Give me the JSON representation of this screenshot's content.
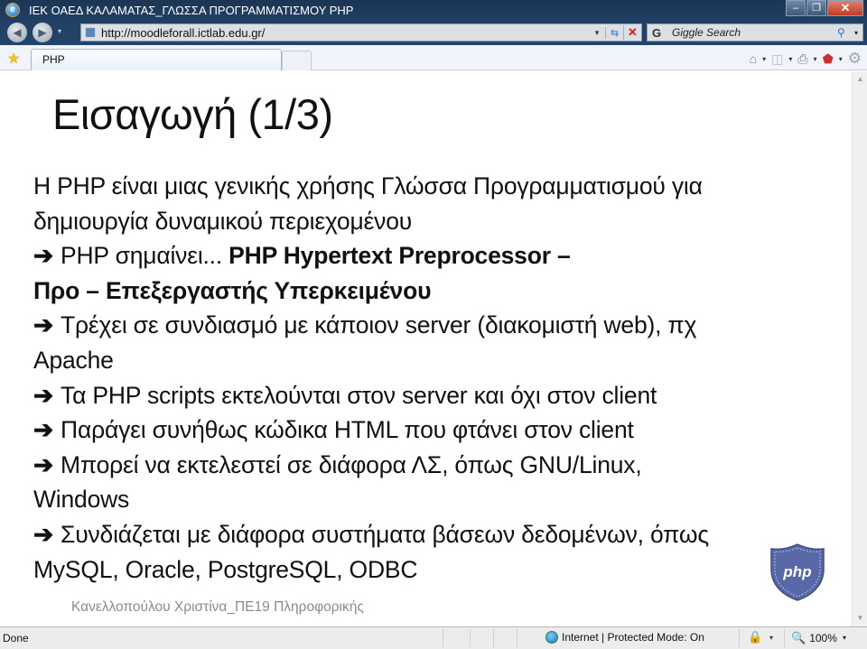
{
  "window": {
    "title": "ΙΕΚ ΟΑΕΔ ΚΑΛΑΜΑΤΑΣ_ΓΛΩΣΣΑ ΠΡΟΓΡΑΜΜΑΤΙΣΜΟΥ PHP",
    "minimize_glyph": "–",
    "restore_glyph": "❐",
    "close_glyph": "✕"
  },
  "navigation": {
    "back_glyph": "◀",
    "forward_glyph": "▶",
    "dropdown_glyph": "▾",
    "url": "http://moodleforall.ictlab.edu.gr/",
    "refresh_glyph": "⇆",
    "stop_glyph": "✕"
  },
  "search": {
    "provider_glyph": "G",
    "placeholder": "Giggle Search",
    "search_glyph": "⚲",
    "dropdown_glyph": "▾"
  },
  "tabs": {
    "active_tab": "PHP",
    "favorites_glyph": "★"
  },
  "command_bar": {
    "home_glyph": "⌂",
    "feeds_glyph": "◫",
    "print_glyph": "⎙",
    "safety_glyph": "⬟",
    "tools_glyph": "⚙",
    "dropdown_glyph": "▾"
  },
  "slide": {
    "title": "Εισαγωγή (1/3)",
    "arrow_glyph": "➔",
    "lines": {
      "l1": "Η PHP είναι μιας γενικής χρήσης Γλώσσα Προγραμματισμού για",
      "l2": "δημιουργία δυναμικού περιεχομένου",
      "l3_plain": "PHP σημαίνει... ",
      "l3_bold": "PHP Hypertext Preprocessor –",
      "l4_bold": "Προ – Επεξεργαστής Υπερκειμένου",
      "l5": "Τρέχει σε συνδιασμό με κάποιον server (διακομιστή web), πχ",
      "l6": "Apache",
      "l7": "Τα PHP scripts εκτελούνται στον server και όχι στον client",
      "l8": "Παράγει συνήθως κώδικα HTML που φτάνει στον client",
      "l9": "Μπορεί να εκτελεστεί σε διάφορα ΛΣ, όπως GNU/Linux,",
      "l10": "Windows",
      "l11": "Συνδιάζεται με διάφορα συστήματα βάσεων δεδομένων, όπως",
      "l12": "MySQL, Oracle, PostgreSQL, ODBC"
    },
    "author": "Κανελλοπούλου Χριστίνα_ΠΕ19 Πληροφορικής",
    "badge_text": "php"
  },
  "scrollbar": {
    "up_glyph": "▲",
    "down_glyph": "▼"
  },
  "status": {
    "left": "Done",
    "zone": "Internet | Protected Mode: On",
    "lock_glyph": "🔒",
    "zoom_glyph": "🔍",
    "zoom_level": "100%",
    "dropdown_glyph": "▾"
  }
}
